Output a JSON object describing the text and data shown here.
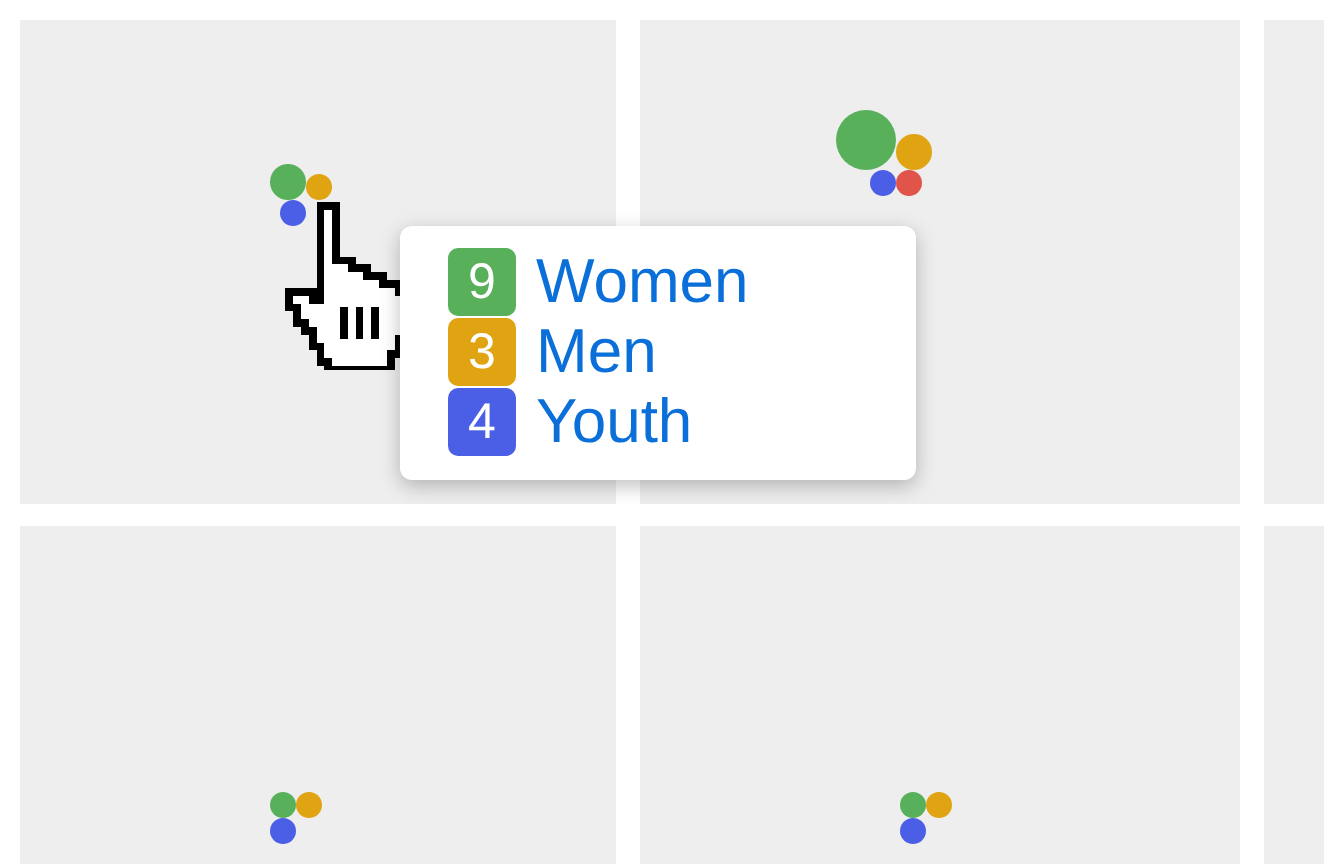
{
  "tiles": [
    {
      "dots": [
        {
          "color": "#58b05b",
          "kind": "medium"
        },
        {
          "color": "#e0a311",
          "kind": "small"
        },
        {
          "color": "#4b5fe6",
          "kind": "small"
        }
      ]
    },
    {
      "dots": [
        {
          "color": "#58b05b",
          "kind": "large"
        },
        {
          "color": "#e0a311",
          "kind": "medium"
        },
        {
          "color": "#4b5fe6",
          "kind": "small"
        },
        {
          "color": "#e0544a",
          "kind": "small"
        }
      ]
    },
    {
      "dots": [
        {
          "color": "#58b05b",
          "kind": "small"
        },
        {
          "color": "#e0a311",
          "kind": "small"
        },
        {
          "color": "#4b5fe6",
          "kind": "small"
        }
      ]
    },
    {
      "dots": [
        {
          "color": "#58b05b",
          "kind": "small"
        },
        {
          "color": "#e0a311",
          "kind": "small"
        },
        {
          "color": "#4b5fe6",
          "kind": "small"
        }
      ]
    }
  ],
  "tooltip": {
    "items": [
      {
        "count": "9",
        "label": "Women",
        "color": "#58b05b"
      },
      {
        "count": "3",
        "label": "Men",
        "color": "#e0a311"
      },
      {
        "count": "4",
        "label": "Youth",
        "color": "#4b5fe6"
      }
    ]
  }
}
